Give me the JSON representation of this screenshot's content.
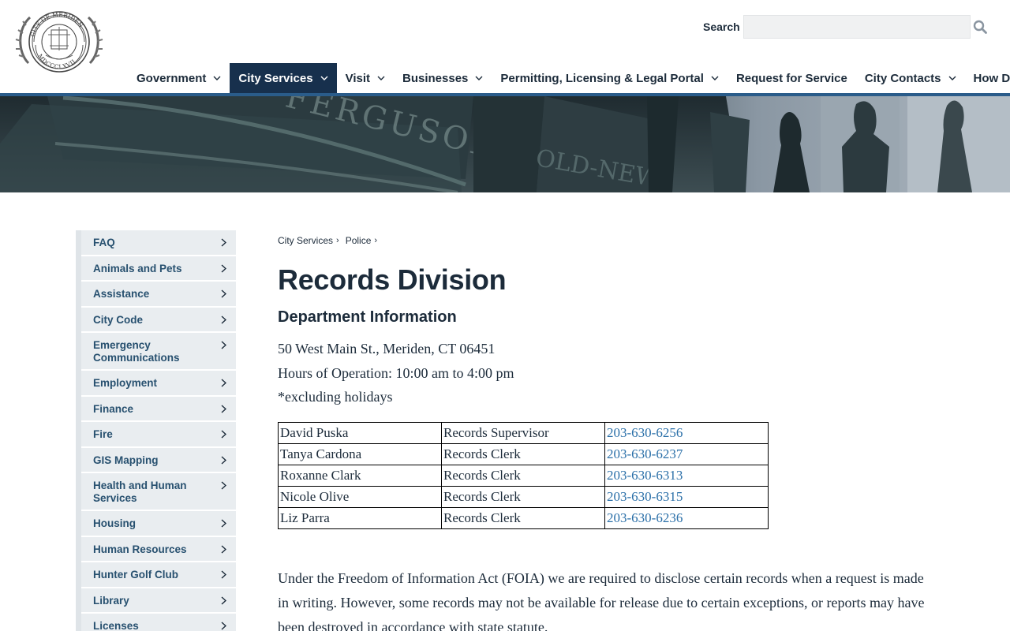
{
  "header": {
    "logo_alt": "City of Meriden seal",
    "logo_text_top": "CITY OF MERIDEN",
    "logo_text_bottom": "MDCCCLXVII",
    "search_label": "Search",
    "search_value": "",
    "search_icon": "search-icon"
  },
  "nav": {
    "items": [
      {
        "label": "Government",
        "has_dropdown": true
      },
      {
        "label": "City Services",
        "has_dropdown": true,
        "active": true
      },
      {
        "label": "Visit",
        "has_dropdown": true
      },
      {
        "label": "Businesses",
        "has_dropdown": true
      },
      {
        "label": "Permitting, Licensing & Legal Portal",
        "has_dropdown": true
      },
      {
        "label": "Request for Service",
        "has_dropdown": false
      },
      {
        "label": "City Contacts",
        "has_dropdown": true
      },
      {
        "label": "How Do I?",
        "has_dropdown": true
      }
    ],
    "active_bg": "#17304d",
    "rule_color": "#2a5c8a"
  },
  "sidebar": {
    "items": [
      {
        "label": "FAQ"
      },
      {
        "label": "Animals and Pets"
      },
      {
        "label": "Assistance"
      },
      {
        "label": "City Code"
      },
      {
        "label": "Emergency Communications"
      },
      {
        "label": "Employment"
      },
      {
        "label": "Finance"
      },
      {
        "label": "Fire"
      },
      {
        "label": "GIS Mapping"
      },
      {
        "label": "Health and Human Services"
      },
      {
        "label": "Housing"
      },
      {
        "label": "Human Resources"
      },
      {
        "label": "Hunter Golf Club"
      },
      {
        "label": "Library"
      },
      {
        "label": "Licenses"
      }
    ]
  },
  "breadcrumb": {
    "items": [
      {
        "label": "City Services"
      },
      {
        "label": "Police"
      }
    ],
    "separator": "›"
  },
  "main": {
    "title": "Records Division",
    "section_title": "Department Information",
    "address": "50 West Main St., Meriden, CT 06451",
    "hours": "Hours of Operation: 10:00 am to 4:00 pm",
    "note": "*excluding holidays",
    "contacts": [
      {
        "name": "David Puska",
        "role": "Records Supervisor",
        "phone": "203-630-6256"
      },
      {
        "name": "Tanya Cardona",
        "role": "Records Clerk",
        "phone": "203-630-6237"
      },
      {
        "name": "Roxanne Clark",
        "role": "Records Clerk",
        "phone": "203-630-6313"
      },
      {
        "name": "Nicole Olive",
        "role": "Records Clerk",
        "phone": "203-630-6315"
      },
      {
        "name": "Liz Parra",
        "role": "Records Clerk",
        "phone": "203-630-6236"
      }
    ],
    "foia_text": "Under the Freedom of Information Act (FOIA) we are required to disclose certain records when a request is made in writing. However, some records may not be available for release due to certain exceptions, or reports may have been destroyed in accordance with state statute.",
    "link_color": "#2a6fa8"
  }
}
